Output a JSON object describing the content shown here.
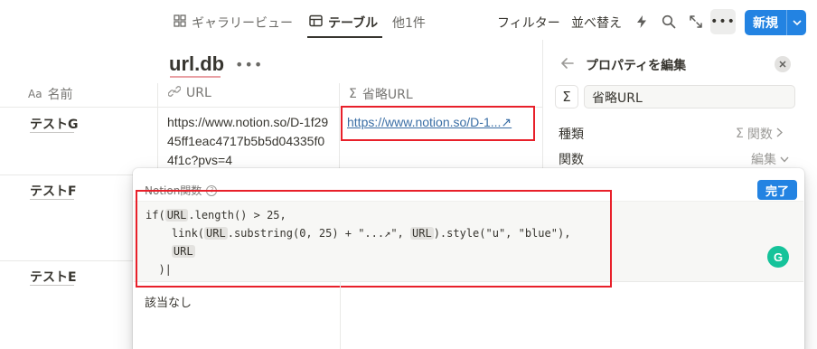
{
  "toolbar": {
    "tabs": [
      {
        "label": "ギャラリービュー",
        "icon": "gallery-icon"
      },
      {
        "label": "テーブル",
        "icon": "table-icon"
      },
      {
        "label": "他1件"
      }
    ],
    "filter_label": "フィルター",
    "sort_label": "並べ替え",
    "new_label": "新規"
  },
  "database": {
    "title": "url.db",
    "columns": [
      {
        "label": "名前",
        "icon_text": "Aa"
      },
      {
        "label": "URL",
        "icon": "link-icon"
      },
      {
        "label": "省略URL",
        "icon_text": "Σ"
      }
    ],
    "rows": [
      {
        "name": "テストG",
        "url": "https://www.notion.so/D-1f2945ff1eac4717b5b5d04335f04f1c?pvs=4",
        "short_url": "https://www.notion.so/D-1...↗"
      },
      {
        "name": "テストF"
      },
      {
        "name": "テストE"
      }
    ]
  },
  "panel": {
    "title": "プロパティを編集",
    "property_name": "省略URL",
    "type_label": "種類",
    "type_value": "関数",
    "function_label": "関数",
    "function_value": "編集"
  },
  "editor": {
    "label": "Notion関数",
    "done_label": "完了",
    "result_text": "該当なし",
    "formula": "if(URL.length() > 25,\n    link(URL.substring(0, 25) + \"...↗\", URL).style(\"u\", \"blue\"),\n    URL\n  )"
  },
  "colors": {
    "accent": "#2383e2",
    "link": "#3a6ea5",
    "highlight_box": "#e8202a"
  }
}
